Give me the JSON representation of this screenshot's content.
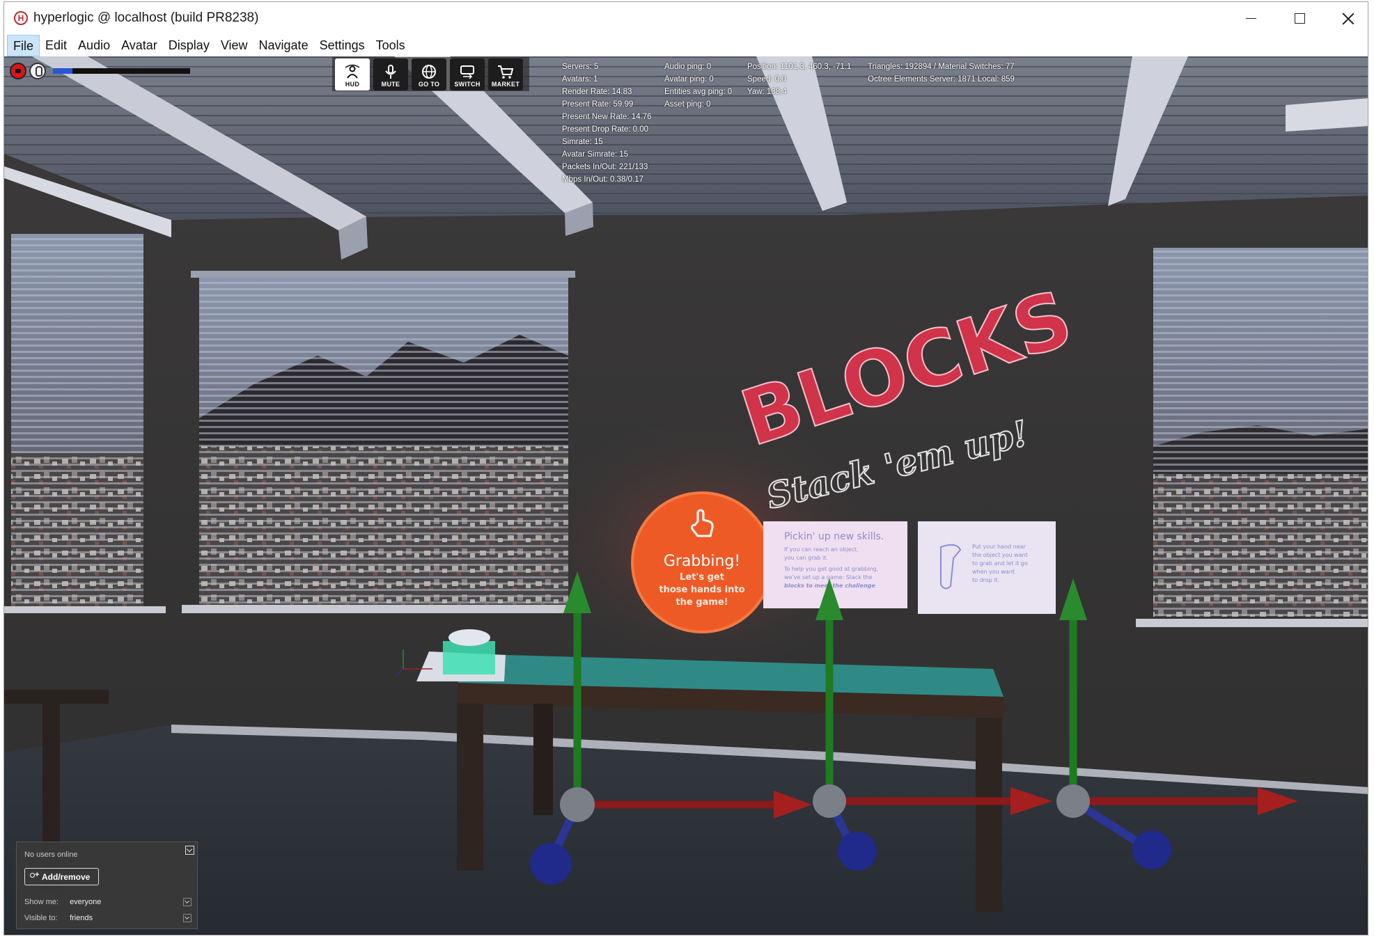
{
  "window": {
    "title": "hyperlogic @ localhost (build PR8238)",
    "app_icon_letter": "H"
  },
  "menu": [
    "File",
    "Edit",
    "Audio",
    "Avatar",
    "Display",
    "View",
    "Navigate",
    "Settings",
    "Tools"
  ],
  "active_menu": "File",
  "hud": {
    "audio_level": 0.14,
    "toolbar": [
      {
        "label": "HUD",
        "icon": "hud-icon",
        "active": true
      },
      {
        "label": "MUTE",
        "icon": "mic-icon",
        "active": false
      },
      {
        "label": "GO TO",
        "icon": "globe-icon",
        "active": false
      },
      {
        "label": "SWITCH",
        "icon": "switch-icon",
        "active": false
      },
      {
        "label": "MARKET",
        "icon": "cart-icon",
        "active": false
      }
    ]
  },
  "stats": {
    "col1": [
      "Servers: 5",
      "Avatars: 1",
      "Render Rate: 14.83",
      "Present Rate: 59.99",
      "Present New Rate: 14.76",
      "Present Drop Rate: 0.00",
      "Simrate: 15",
      "Avatar Simrate: 15",
      "Packets In/Out: 221/133",
      "Mbps In/Out: 0.38/0.17"
    ],
    "col2": [
      "Audio ping: 0",
      "Avatar ping: 0",
      "Entities avg ping: 0",
      "Asset ping: 0"
    ],
    "col3": [
      "Position: 1101.3, 460.3, -71.1",
      "Speed: 0.0",
      "Yaw: 138.4"
    ],
    "col4": [
      "Triangles: 192894 / Material Switches: 77",
      "Octree Elements Server: 1871 Local: 859"
    ]
  },
  "scene": {
    "sign_title": "BLOCKS",
    "sign_subtitle": "Stack 'em up!",
    "badge_title": "Grabbing!",
    "badge_line1": "Let's get",
    "badge_line2": "those hands into",
    "badge_line3": "the game!",
    "card1_title": "Pickin' up new skills.",
    "card1_lines": [
      "If you can reach an object,",
      "you can grab it.",
      "To help you get good at grabbing,",
      "we've set up a game: Stack the",
      "blocks to meet the challenge"
    ],
    "card2_lines": [
      "Put your hand near",
      "the object you want",
      "to grab and let it go",
      "when you want",
      "to drop it."
    ]
  },
  "users_panel": {
    "status": "No users online",
    "add_button": "Add/remove",
    "show_label": "Show me:",
    "show_value": "everyone",
    "visible_label": "Visible to:",
    "visible_value": "friends"
  }
}
